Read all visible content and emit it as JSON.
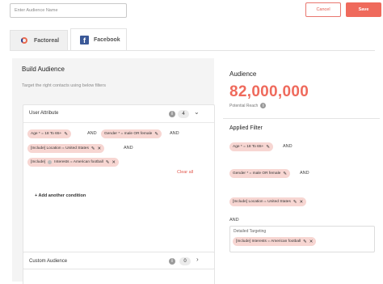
{
  "header": {
    "audience_name_placeholder": "Enter Audience Name",
    "cancel_label": "Cancel",
    "save_label": "Save"
  },
  "tabs": [
    {
      "label": "Factoreal",
      "active": false
    },
    {
      "label": "Facebook",
      "active": true
    }
  ],
  "build": {
    "title": "Build Audience",
    "subtitle": "Target the right contacts using below filters",
    "user_attribute": {
      "title": "User Attribute",
      "count": "4",
      "chips": [
        {
          "label": "Age * = 18 To 65+"
        },
        {
          "label": "Gender * = male OR female"
        },
        {
          "label": "[Include] Location = United States"
        },
        {
          "label": "[Include]",
          "label2": "Interests = American football"
        }
      ],
      "and_label": "AND",
      "clear_all": "Clear all",
      "add_condition": "+ Add another condition"
    },
    "custom_audience": {
      "title": "Custom Audience",
      "count": "0"
    }
  },
  "summary": {
    "title": "Audience",
    "potential_count": "82,000,000",
    "potential_label": "Potential Reach",
    "applied_filter_title": "Applied Filter",
    "chips": [
      {
        "label": "Age * = 18 To 65+"
      },
      {
        "label": "Gender * = male OR female"
      },
      {
        "label": "[Include] Location = United States"
      }
    ],
    "and_label": "AND",
    "detailed_targeting_label": "Detailed Targeting",
    "detailed_chip": "[Include] Interests = American football"
  },
  "colors": {
    "accent": "#ef6a5c",
    "chip_bg": "#f7d6d2",
    "facebook_blue": "#3b5998"
  },
  "icons": [
    "facebook-icon",
    "factoreal-logo-icon",
    "edit-pencil-icon",
    "close-icon",
    "info-icon",
    "chevron-down-icon",
    "chevron-right-icon",
    "help-icon"
  ]
}
